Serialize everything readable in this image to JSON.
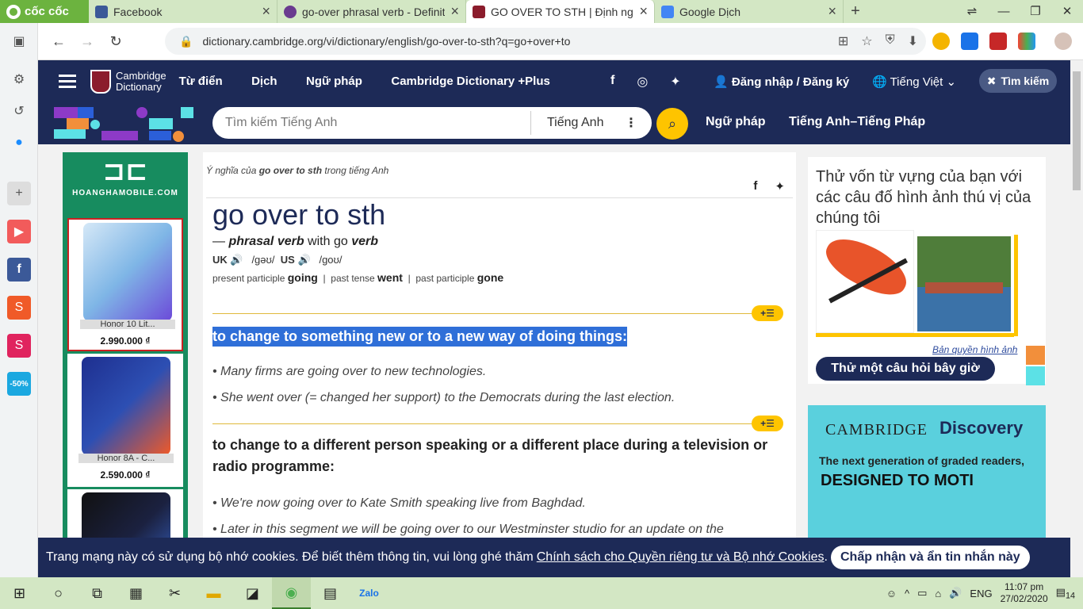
{
  "browser": {
    "brand": "cốc cốc",
    "tabs": [
      {
        "title": "Facebook",
        "color": "#3b5998"
      },
      {
        "title": "go-over phrasal verb - Definiti",
        "color": "#6a3b8f"
      },
      {
        "title": "GO OVER TO STH | Định nghĩ",
        "color": "#8b1c2c"
      },
      {
        "title": "Google Dịch",
        "color": "#4285f4"
      }
    ],
    "url": "dictionary.cambridge.org/vi/dictionary/english/go-over-to-sth?q=go+over+to"
  },
  "site": {
    "logo_line1": "Cambridge",
    "logo_line2": "Dictionary",
    "menu": [
      "Từ điển",
      "Dịch",
      "Ngữ pháp",
      "Cambridge Dictionary +Plus"
    ],
    "login": "Đăng nhập / Đăng ký",
    "language": "Tiếng Việt",
    "close_search": "Tìm kiếm",
    "search_placeholder": "Tìm kiếm Tiếng Anh",
    "search_dict": "Tiếng Anh",
    "link_grammar": "Ngữ pháp",
    "link_fr": "Tiếng Anh–Tiếng Pháp"
  },
  "ad_left": {
    "domain": "HOANGHAMOBILE.COM",
    "products": [
      {
        "name": "Honor 10 Lit...",
        "price": "2.990.000 ₫",
        "color": "#7fb6e6"
      },
      {
        "name": "Honor 8A - C...",
        "price": "2.590.000 ₫",
        "color": "#2d4fb3"
      },
      {
        "name": "",
        "price": "",
        "color": "#1b2140"
      }
    ]
  },
  "entry": {
    "crumb_pre": "Ý nghĩa của ",
    "crumb_word": "go over to sth",
    "crumb_post": " trong tiếng Anh",
    "headword": "go over to sth",
    "pos_dash": "— ",
    "pos": "phrasal verb",
    "pos_with": " with go ",
    "pos_verb": "verb",
    "uk": "UK",
    "uk_ipa": "/ɡəʊ/",
    "us": "US",
    "us_ipa": "/ɡoʊ/",
    "pp_label": "present participle",
    "pp": "going",
    "pt_label": "past tense",
    "pt": "went",
    "pap_label": "past participle",
    "pap": "gone",
    "def1": "to change to something new or to a new way of doing things:",
    "ex1": [
      "Many firms are going over to new technologies.",
      "She went over (= changed her support) to the Democrats during the last election."
    ],
    "def2": "to change to a different person speaking or a different place during a television or radio programme:",
    "ex2": [
      "We're now going over to Kate Smith speaking live from Baghdad.",
      "Later in this segment we will be going over to our Westminster studio for an update on the"
    ]
  },
  "sidebar": {
    "quiz_title": "Thử vốn từ vựng của bạn với các câu đố hình ảnh thú vị của chúng tôi",
    "copyright": "Bản quyền hình ảnh",
    "quiz_button": "Thử một câu hỏi bây giờ",
    "ad2_cambridge": "CAMBRIDGE",
    "ad2_discovery": "Discovery",
    "ad2_line1": "The next generation of graded readers,",
    "ad2_line2": "DESIGNED TO MOTI"
  },
  "cookie": {
    "text": "Trang mạng này có sử dụng bộ nhớ cookies. Để biết thêm thông tin, vui lòng ghé thăm",
    "link": "Chính sách cho Quyền riêng tư và Bộ nhớ Cookies",
    "button": "Chấp nhận và ẩn tin nhắn này"
  },
  "taskbar": {
    "lang": "ENG",
    "time": "11:07 pm",
    "date": "27/02/2020",
    "notifications": "14"
  }
}
